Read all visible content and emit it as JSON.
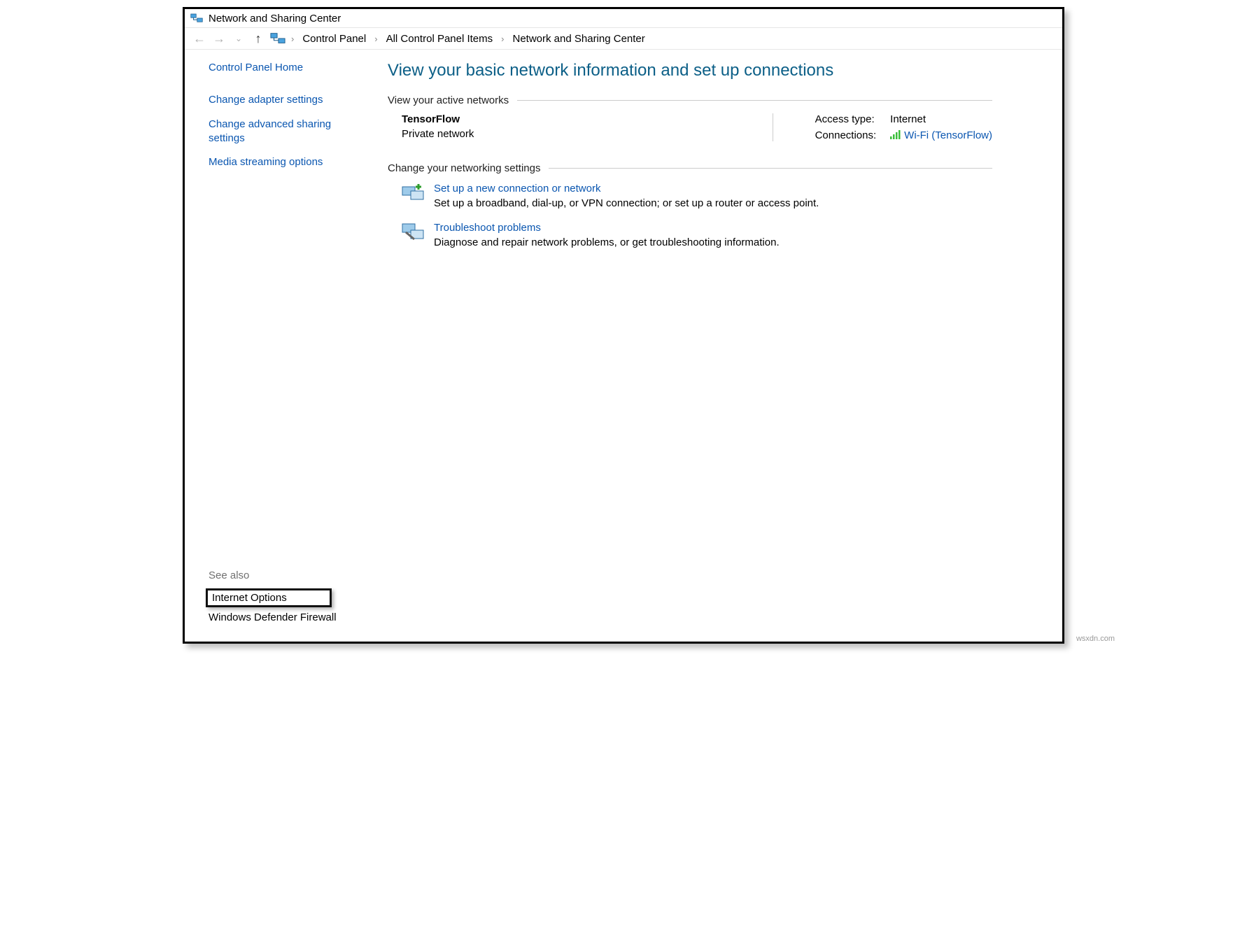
{
  "window_title": "Network and Sharing Center",
  "breadcrumb": [
    "Control Panel",
    "All Control Panel Items",
    "Network and Sharing Center"
  ],
  "sidebar": {
    "home": "Control Panel Home",
    "links": [
      "Change adapter settings",
      "Change advanced sharing settings",
      "Media streaming options"
    ],
    "see_also_label": "See also",
    "see_also": [
      "Internet Options",
      "Windows Defender Firewall"
    ]
  },
  "main": {
    "heading": "View your basic network information and set up connections",
    "active_networks_label": "View your active networks",
    "network": {
      "name": "TensorFlow",
      "type": "Private network",
      "access_label": "Access type:",
      "access_value": "Internet",
      "conn_label": "Connections:",
      "conn_value": "Wi-Fi (TensorFlow)"
    },
    "change_settings_label": "Change your networking settings",
    "items": [
      {
        "title": "Set up a new connection or network",
        "desc": "Set up a broadband, dial-up, or VPN connection; or set up a router or access point."
      },
      {
        "title": "Troubleshoot problems",
        "desc": "Diagnose and repair network problems, or get troubleshooting information."
      }
    ]
  },
  "watermark": "wsxdn.com"
}
